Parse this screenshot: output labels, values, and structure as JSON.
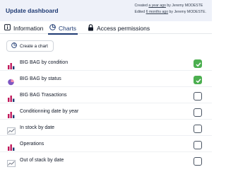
{
  "header": {
    "title": "Update dashboard",
    "created_prefix": "Created ",
    "created_when": "a year ago",
    "created_mid": " by ",
    "created_by": "Jeremy MODESTE",
    "edited_prefix": "Edited ",
    "edited_when": "6 months ago",
    "edited_mid": " by ",
    "edited_by": "Jeremy MODESTE."
  },
  "tabs": [
    {
      "label": "Information",
      "icon": "info-icon"
    },
    {
      "label": "Charts",
      "icon": "chart-pie-icon",
      "active": true
    },
    {
      "label": "Access permissions",
      "icon": "lock-icon"
    }
  ],
  "create_button": {
    "label": "Create a chart",
    "icon": "chart-pie-icon"
  },
  "charts": [
    {
      "label": "BIG BAG by condition",
      "icon": "bar-chart-icon",
      "checked": true
    },
    {
      "label": "BIG BAG by status",
      "icon": "pie-chart-icon",
      "checked": true
    },
    {
      "label": "BIG BAG Trasactions",
      "icon": "bar-chart-icon",
      "checked": false
    },
    {
      "label": "Conditionning date by year",
      "icon": "bar-chart-icon",
      "checked": false
    },
    {
      "label": "In stock by date",
      "icon": "line-chart-icon",
      "checked": false
    },
    {
      "label": "Operations",
      "icon": "bar-chart-icon",
      "checked": false
    },
    {
      "label": "Out of stack by date",
      "icon": "line-chart-icon",
      "checked": false
    }
  ],
  "colors": {
    "accent": "#1f3b73",
    "bar_icon": "#c2185b",
    "pie_icon": "#7e57c2",
    "check_green": "#4caf50"
  }
}
